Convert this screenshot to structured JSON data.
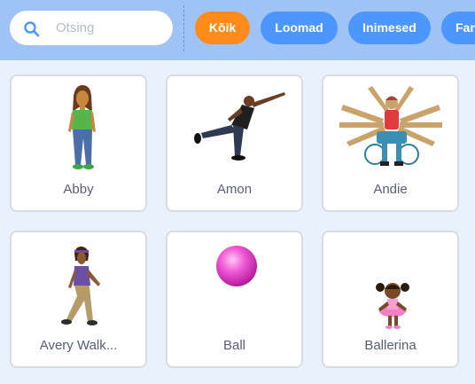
{
  "search": {
    "placeholder": "Otsing"
  },
  "tags": [
    {
      "label": "Kõik",
      "active": true
    },
    {
      "label": "Loomad",
      "active": false
    },
    {
      "label": "Inimesed",
      "active": false
    },
    {
      "label": "Fan",
      "active": false
    }
  ],
  "sprites": [
    {
      "name": "Abby"
    },
    {
      "name": "Amon"
    },
    {
      "name": "Andie"
    },
    {
      "name": "Avery Walk..."
    },
    {
      "name": "Ball"
    },
    {
      "name": "Ballerina"
    }
  ],
  "colors": {
    "topbar": "#9fc3f5",
    "background": "#e9f1fc",
    "tag": "#4c97ff",
    "tag_active": "#ff8c1a",
    "label_text": "#575e75"
  },
  "icons": {
    "search": "search-icon"
  }
}
